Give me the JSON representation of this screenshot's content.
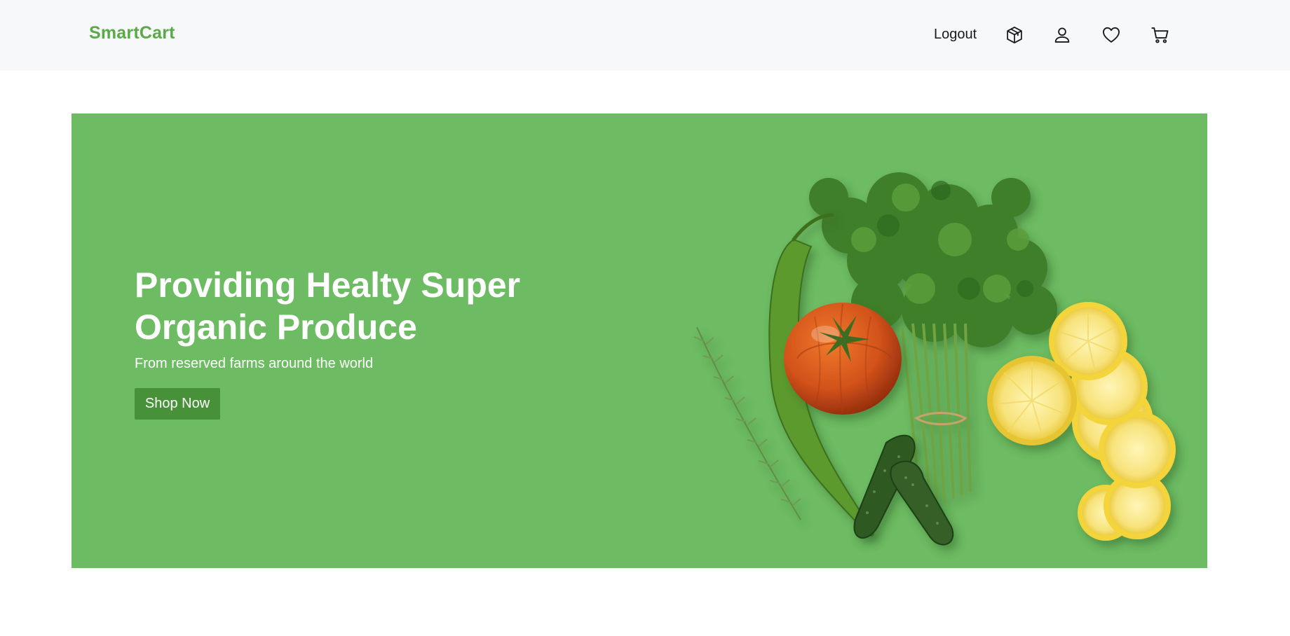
{
  "navbar": {
    "brand": "SmartCart",
    "logout_label": "Logout",
    "icons": [
      "package-icon",
      "user-icon",
      "heart-icon",
      "cart-icon"
    ]
  },
  "hero": {
    "title": "Providing Healty Super Organic Produce",
    "subtitle": "From reserved farms around the world",
    "cta_label": "Shop Now",
    "image_description_icon": "vegetables-image"
  },
  "colors": {
    "brand": "#5aaa48",
    "hero_background": "#6dbb63",
    "button_background": "#479139",
    "navbar_background": "#f7f8fa"
  }
}
